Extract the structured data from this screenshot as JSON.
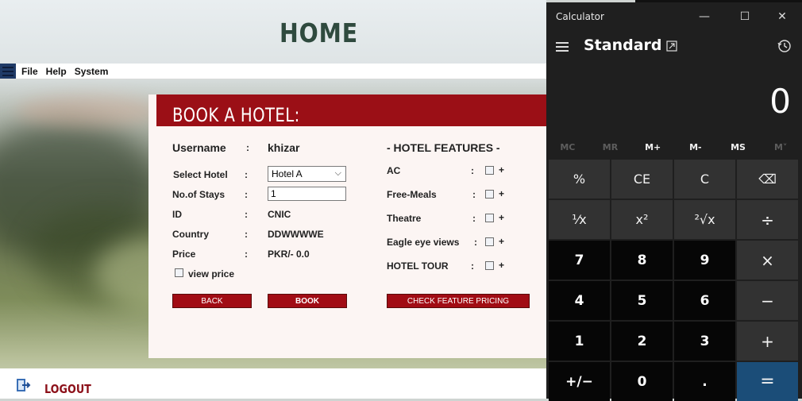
{
  "app": {
    "title": "HOME",
    "menu": [
      "File",
      "Help",
      "System"
    ],
    "panel_title": "BOOK A HOTEL:",
    "username_label": "Username",
    "username_value": "khizar",
    "colon": ":",
    "fields": [
      {
        "label": "Select Hotel"
      },
      {
        "label": "No.of Stays"
      },
      {
        "label": "ID",
        "value": "CNIC"
      },
      {
        "label": "Country",
        "value": "DDWWWWE"
      },
      {
        "label": "Price",
        "value": "PKR/- 0.0"
      }
    ],
    "select_value": "Hotel A",
    "stays_value": "1",
    "view_price_label": "view price",
    "features_title": "- HOTEL FEATURES -",
    "features": [
      "AC",
      "Free-Meals",
      "Theatre",
      "Eagle eye views",
      "HOTEL TOUR"
    ],
    "plus": "+",
    "buttons": {
      "back": "BACK",
      "book": "BOOK",
      "check": "CHECK FEATURE PRICING"
    },
    "logout": "LOGOUT",
    "colors": {
      "accent": "#9b0f16",
      "title": "#2f4a3e"
    }
  },
  "calculator": {
    "title": "Calculator",
    "mode": "Standard",
    "display": "0",
    "memory": [
      "MC",
      "MR",
      "M+",
      "M-",
      "MS",
      "M˅"
    ],
    "keys": [
      "%",
      "CE",
      "C",
      "⌫",
      "¹⁄x",
      "x²",
      "²√x",
      "÷",
      "7",
      "8",
      "9",
      "×",
      "4",
      "5",
      "6",
      "−",
      "1",
      "2",
      "3",
      "+",
      "+/−",
      "0",
      ".",
      "="
    ],
    "window_buttons": [
      "—",
      "☐",
      "✕"
    ]
  }
}
